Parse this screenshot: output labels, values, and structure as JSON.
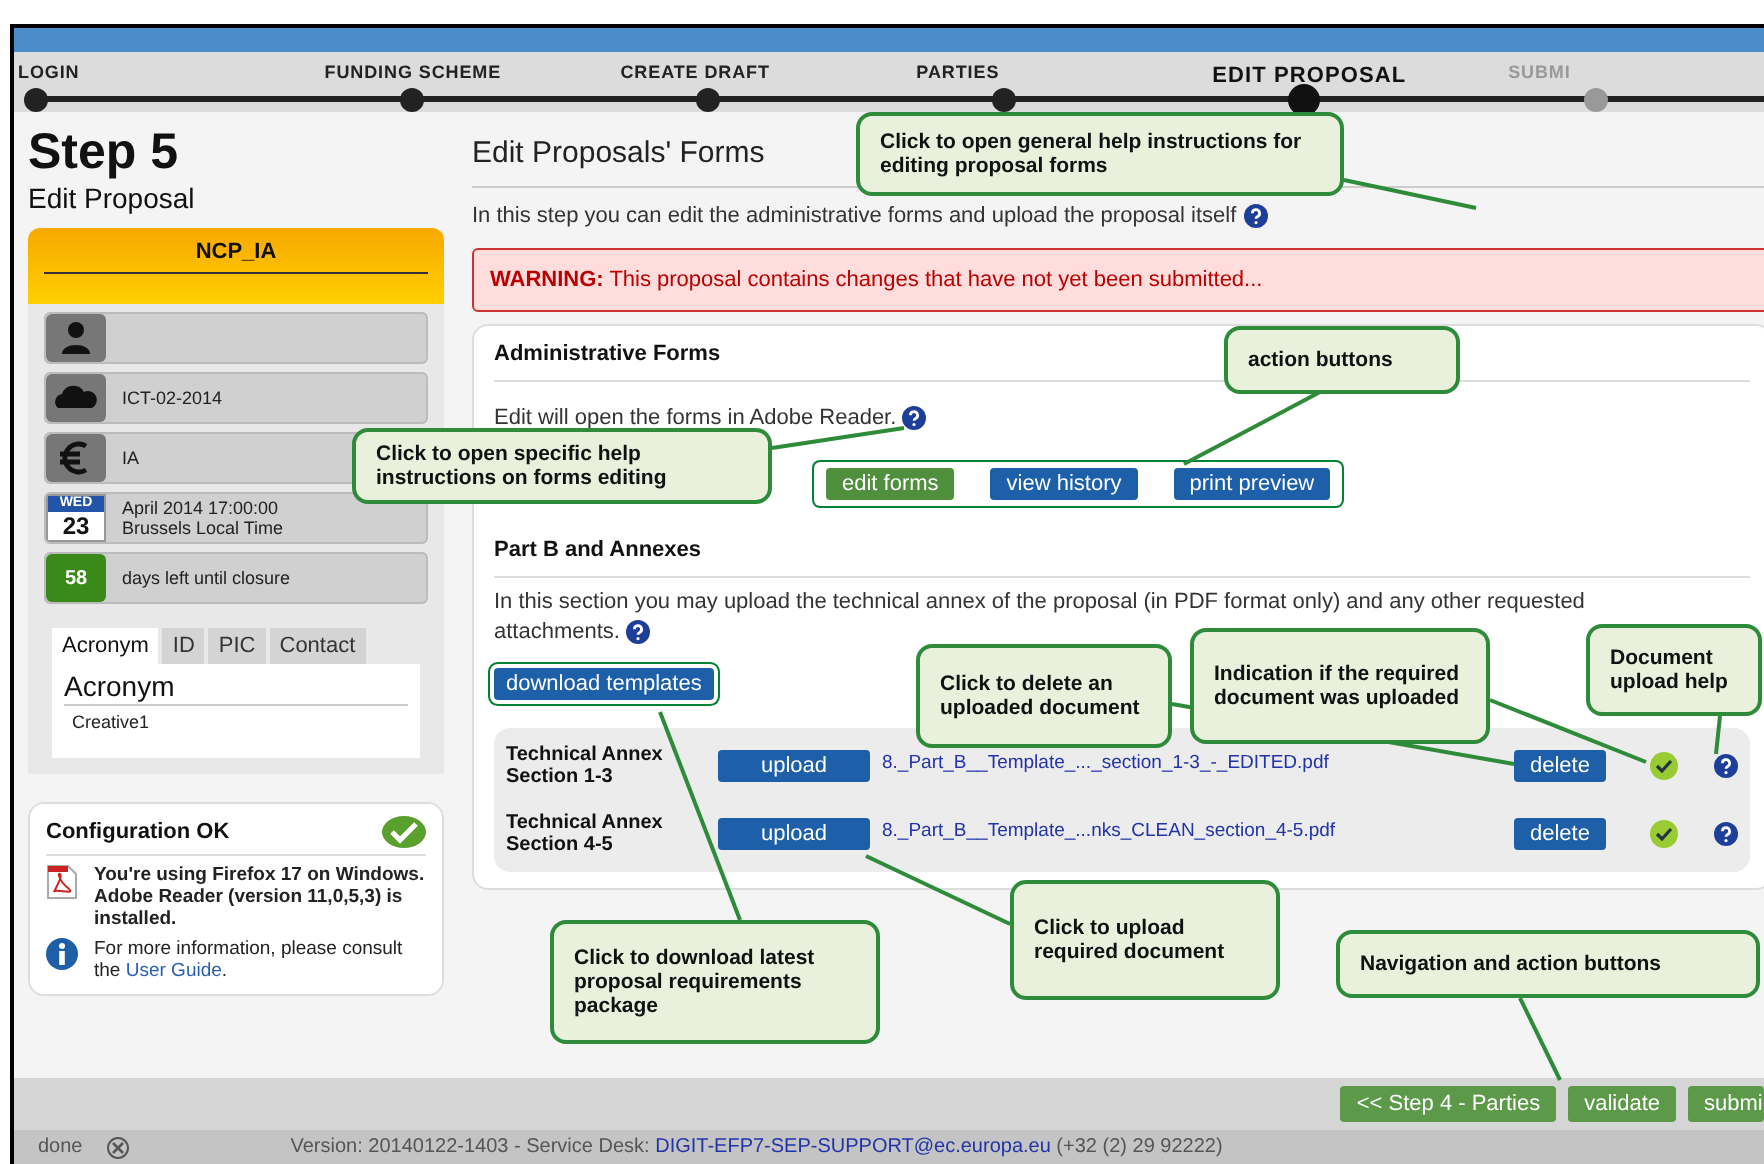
{
  "steps": [
    {
      "label": "LOGIN",
      "completed": true,
      "selected": false
    },
    {
      "label": "FUNDING SCHEME",
      "completed": true,
      "selected": false
    },
    {
      "label": "CREATE DRAFT",
      "completed": true,
      "selected": false
    },
    {
      "label": "PARTIES",
      "completed": true,
      "selected": false
    },
    {
      "label": "EDIT PROPOSAL",
      "completed": false,
      "selected": true
    },
    {
      "label": "SUBMI",
      "completed": false,
      "selected": false
    }
  ],
  "sidebar": {
    "step": "Step 5",
    "subtitle": "Edit Proposal",
    "header": "NCP_IA",
    "info": [
      {
        "kind": "person"
      },
      {
        "kind": "call",
        "text": "ICT-02-2014"
      },
      {
        "kind": "budget",
        "text": "IA"
      },
      {
        "kind": "deadline",
        "day_name": "WED",
        "day": "23",
        "text": "April 2014  17:00:00",
        "text2": "Brussels Local Time"
      },
      {
        "kind": "countdown",
        "count": "58",
        "text": "days left until closure"
      }
    ],
    "tabs": [
      {
        "label": "Acronym",
        "selected": true
      },
      {
        "label": "ID",
        "selected": false
      },
      {
        "label": "PIC",
        "selected": false
      },
      {
        "label": "Contact",
        "selected": false
      }
    ],
    "field_label": "Acronym",
    "field_value": "Creative1",
    "config": {
      "title": "Configuration OK",
      "message": "You're using Firefox 17 on Windows. Adobe Reader (version 11,0,5,3) is installed.",
      "info": "For more information, please consult the",
      "link": "User Guide",
      "info_end": "."
    }
  },
  "main": {
    "title": "Edit Proposals' Forms",
    "intro": "In this step you can edit the administrative forms and upload the proposal itself",
    "warning_label": "WARNING:",
    "warning": "This proposal contains changes that have not yet been submitted...",
    "admin": {
      "heading": "Administrative Forms",
      "text": "Edit will open the forms in Adobe Reader.",
      "buttons": [
        {
          "label": "edit forms",
          "kind": "primary"
        },
        {
          "label": "view history",
          "kind": "secondary"
        },
        {
          "label": "print preview",
          "kind": "secondary"
        }
      ]
    },
    "part_b": {
      "heading": "Part B and Annexes",
      "text": "In this section you may upload the technical annex of the proposal (in PDF format only) and any other requested attachments.",
      "download": "download templates",
      "documents": [
        {
          "name": "Technical Annex Section 1-3",
          "upload": "upload",
          "file": "8._Part_B__Template_..._section_1-3_-_EDITED.pdf",
          "delete": "delete",
          "uploaded": true
        },
        {
          "name": "Technical Annex Section 4-5",
          "upload": "upload",
          "file": "8._Part_B__Template_...nks_CLEAN_section_4-5.pdf",
          "delete": "delete",
          "uploaded": true
        }
      ]
    }
  },
  "footer_buttons": [
    "<< Step 4 - Parties",
    "validate",
    "submi"
  ],
  "status_bar": {
    "state": "done",
    "version": "Version: 20140122-1403 - Service Desk:",
    "email": "DIGIT-EFP7-SEP-SUPPORT@ec.europa.eu",
    "phone": "(+32 (2) 29 92222)"
  },
  "callouts": [
    "Click to open general help instructions for editing proposal forms",
    "action buttons",
    "Click to open specific help instructions on forms editing",
    "Click to download latest proposal requirements package",
    "Click to delete an uploaded document",
    "Indication if the required document was uploaded",
    "Document upload help",
    "Click to upload required document",
    "Navigation and action buttons"
  ]
}
